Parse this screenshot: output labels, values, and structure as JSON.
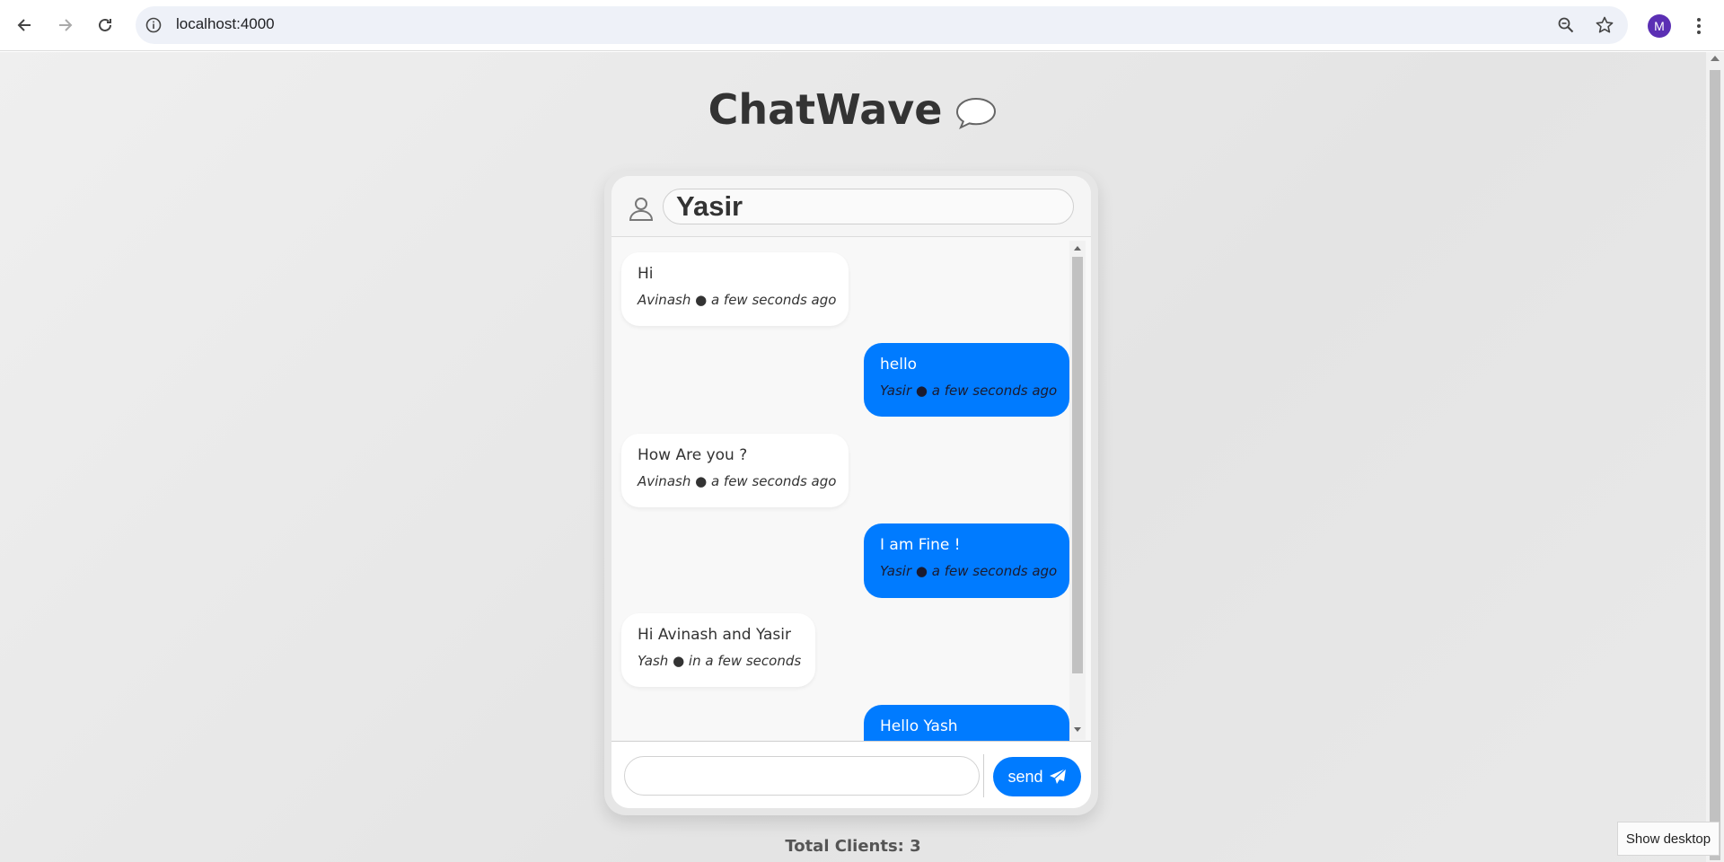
{
  "browser": {
    "url": "localhost:4000",
    "avatar_initial": "M"
  },
  "app": {
    "title": "ChatWave",
    "title_icon": "speech-bubble-icon"
  },
  "header": {
    "user_icon": "user-icon",
    "name_value": "Yasir"
  },
  "messages": [
    {
      "side": "left",
      "text": "Hi",
      "meta": "Avinash ● a few seconds ago"
    },
    {
      "side": "right",
      "text": "hello",
      "meta": "Yasir ● a few seconds ago"
    },
    {
      "side": "left",
      "text": "How Are you ?",
      "meta": "Avinash ● a few seconds ago"
    },
    {
      "side": "right",
      "text": "I am Fine !",
      "meta": "Yasir ● a few seconds ago"
    },
    {
      "side": "left",
      "text": "Hi Avinash and Yasir",
      "meta": "Yash ● in a few seconds"
    },
    {
      "side": "right",
      "text": "Hello Yash",
      "meta": ""
    }
  ],
  "composer": {
    "input_value": "",
    "send_label": "send",
    "send_icon": "paper-plane-icon"
  },
  "footer": {
    "total_clients": "Total Clients: 3"
  },
  "taskbar": {
    "tooltip": "Show desktop"
  },
  "colors": {
    "accent": "#007bff",
    "background": "#e8e8e8"
  }
}
